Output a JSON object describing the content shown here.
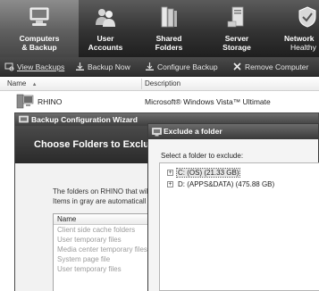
{
  "nav": {
    "tabs": [
      {
        "line1": "Computers",
        "line2": "& Backup",
        "icon": "computers-icon"
      },
      {
        "line1": "User",
        "line2": "Accounts",
        "icon": "users-icon"
      },
      {
        "line1": "Shared",
        "line2": "Folders",
        "icon": "shared-folders-icon"
      },
      {
        "line1": "Server",
        "line2": "Storage",
        "icon": "server-storage-icon"
      },
      {
        "line1": "Network",
        "line2": "Healthy",
        "icon": "network-shield-icon"
      }
    ]
  },
  "toolbar": {
    "view_backups": "View Backups",
    "backup_now": "Backup Now",
    "configure_backup": "Configure Backup",
    "remove_computer": "Remove Computer"
  },
  "list": {
    "col_name": "Name",
    "col_description": "Description",
    "rows": [
      {
        "name": "RHINO",
        "description": "Microsoft® Windows Vista™ Ultimate"
      }
    ]
  },
  "wizard": {
    "title": "Backup Configuration Wizard",
    "heading": "Choose Folders to Exclude",
    "text_line1": "The folders on RHINO that wil",
    "text_line2": "Items in gray are automaticall",
    "list_header": "Name",
    "items": [
      "Client side cache folders",
      "User temporary files",
      "Media center temporary files",
      "System page file",
      "User temporary files"
    ]
  },
  "exclude_dialog": {
    "title": "Exclude a folder",
    "label": "Select a folder to exclude:",
    "nodes": [
      {
        "expander": "+",
        "label": "C: (OS) (21.33 GB)",
        "selected": true
      },
      {
        "expander": "+",
        "label": "D: (APPS&DATA) (475.88 GB)",
        "selected": false
      }
    ]
  },
  "colors": {
    "nav_bg": "#2b2b2b",
    "nav_active": "#6a6a6a",
    "toolbar_bg": "#3a3a3a",
    "dialog_title": "#4a4a4a"
  }
}
